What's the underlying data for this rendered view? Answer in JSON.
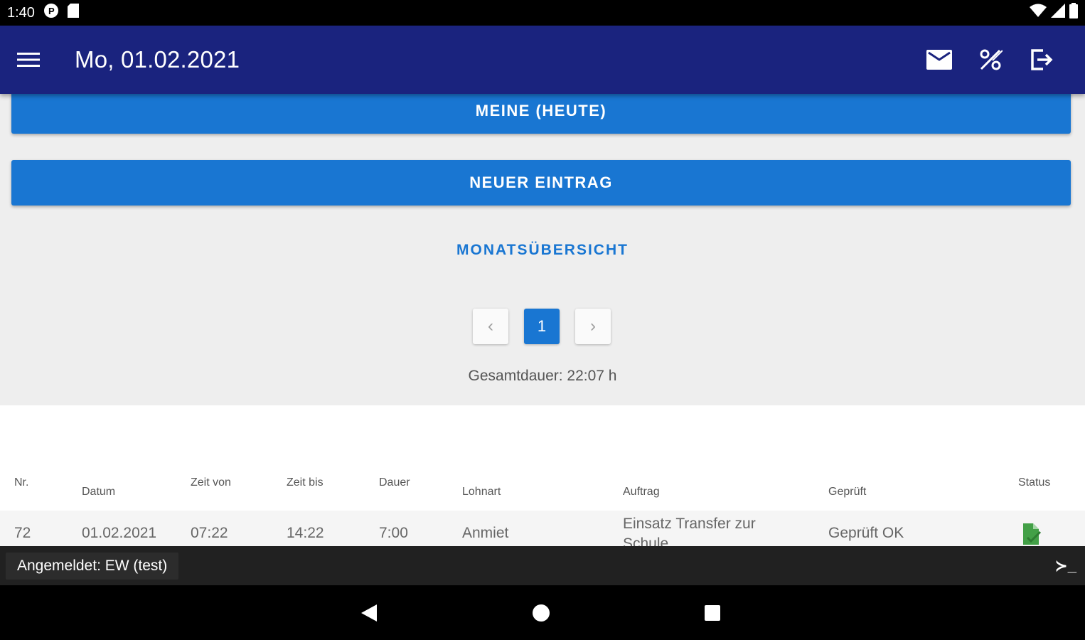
{
  "status_bar": {
    "time": "1:40"
  },
  "app_bar": {
    "title": "Mo, 01.02.2021"
  },
  "buttons": {
    "meine_heute": "MEINE (HEUTE)",
    "neuer_eintrag": "NEUER EINTRAG",
    "monatsuebersicht": "MONATSÜBERSICHT"
  },
  "pagination": {
    "current_page": "1",
    "prev": "‹",
    "next": "›"
  },
  "total": "Gesamtdauer: 22:07 h",
  "table": {
    "headers": [
      "Nr.",
      "Datum",
      "Zeit von",
      "Zeit bis",
      "Dauer",
      "Lohnart",
      "Auftrag",
      "Geprüft",
      "Status"
    ],
    "rows": [
      {
        "nr": "72",
        "datum": "01.02.2021",
        "zeit_von": "07:22",
        "zeit_bis": "14:22",
        "dauer": "7:00",
        "lohnart": "Anmiet",
        "auftrag": "Einsatz Transfer zur Schule",
        "geprueft": "Geprüft OK",
        "status_icon": "document-check-icon"
      }
    ]
  },
  "bottom_bar": {
    "login": "Angemeldet: EW (test)",
    "terminal": "≻_"
  },
  "colors": {
    "appbar": "#1a237e",
    "primary": "#1976d2",
    "status_ok": "#43a047"
  }
}
